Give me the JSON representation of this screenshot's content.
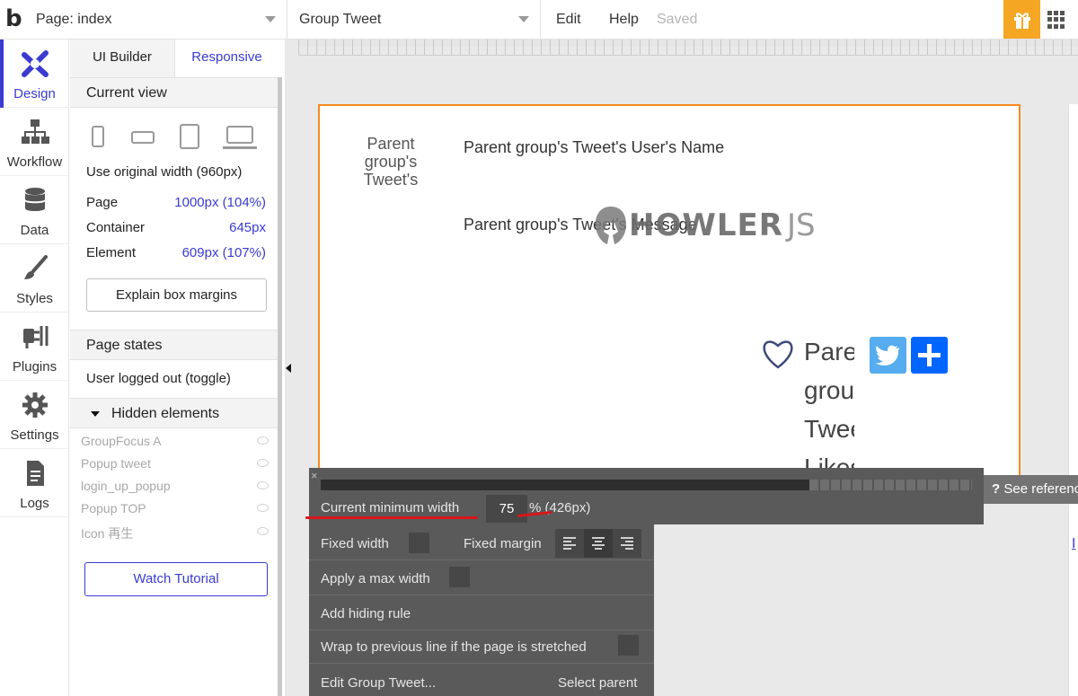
{
  "topbar": {
    "logo": "b",
    "page_select": "Page: index",
    "element_select": "Group Tweet",
    "menu_edit": "Edit",
    "menu_help": "Help",
    "status": "Saved"
  },
  "leftnav": {
    "items": [
      {
        "label": "Design",
        "icon": "design-tools-icon"
      },
      {
        "label": "Workflow",
        "icon": "workflow-icon"
      },
      {
        "label": "Data",
        "icon": "database-icon"
      },
      {
        "label": "Styles",
        "icon": "brush-icon"
      },
      {
        "label": "Plugins",
        "icon": "plug-icon"
      },
      {
        "label": "Settings",
        "icon": "gear-icon"
      },
      {
        "label": "Logs",
        "icon": "document-icon"
      }
    ]
  },
  "panel": {
    "tab_ui": "UI Builder",
    "tab_responsive": "Responsive",
    "current_view": "Current view",
    "use_original": "Use original width (960px)",
    "page_label": "Page",
    "page_value": "1000px (104%)",
    "container_label": "Container",
    "container_value": "645px",
    "element_label": "Element",
    "element_value": "609px (107%)",
    "explain_btn": "Explain box margins",
    "page_states": "Page states",
    "user_logged_out": "User logged out (toggle)",
    "hidden_elements": "Hidden elements",
    "hidden_items": [
      "GroupFocus A",
      "Popup tweet",
      "login_up_popup",
      "Popup TOP",
      "Icon 再生"
    ],
    "watch_tutorial": "Watch Tutorial"
  },
  "canvas": {
    "avatar_text": "Parent group's Tweet's",
    "tweet_name": "Parent group's Tweet's User's Name",
    "tweet_message": "Parent group's Tweet's Message",
    "howler": "HOWLER",
    "howler_js": "JS",
    "likes_text": "Parent group's Tweet's Likes",
    "see_reference": "See reference",
    "right_link": "I"
  },
  "popup": {
    "close": "×",
    "min_width_label": "Current minimum width",
    "min_width_value": "75",
    "min_width_suffix": "% (426px)",
    "min_width_fraction": 0.75,
    "fixed_width": "Fixed width",
    "fixed_margin": "Fixed margin",
    "max_width": "Apply a max width",
    "hiding_rule": "Add hiding rule",
    "wrap": "Wrap to previous line if the page is stretched",
    "edit_group": "Edit Group Tweet...",
    "select_parent": "Select parent"
  },
  "colors": {
    "accent": "#3b3bd1",
    "orange": "#f58b1f",
    "gift": "#f5a623",
    "twitter": "#55acee",
    "addtoany": "#0166ff",
    "annotation": "#d8161b"
  }
}
